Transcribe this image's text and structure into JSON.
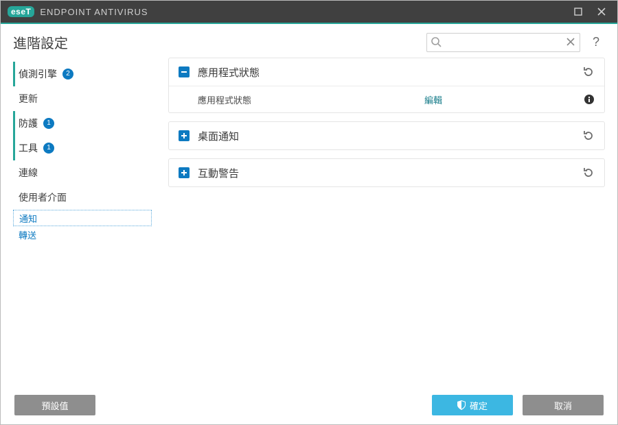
{
  "titlebar": {
    "brand_short": "eseT",
    "brand_text": "ENDPOINT ANTIVIRUS"
  },
  "header": {
    "title": "進階設定",
    "search_placeholder": ""
  },
  "sidebar": {
    "items": [
      {
        "label": "偵測引擎",
        "badge": "2"
      },
      {
        "label": "更新"
      },
      {
        "label": "防護",
        "badge": "1"
      },
      {
        "label": "工具",
        "badge": "1"
      },
      {
        "label": "連線"
      },
      {
        "label": "使用者介面"
      }
    ],
    "sub": [
      {
        "label": "通知"
      },
      {
        "label": "轉送"
      }
    ]
  },
  "panels": {
    "p0": {
      "title": "應用程式狀態",
      "row_label": "應用程式狀態",
      "row_link": "編輯"
    },
    "p1": {
      "title": "桌面通知"
    },
    "p2": {
      "title": "互動警告"
    }
  },
  "footer": {
    "defaults": "預設值",
    "ok": "確定",
    "cancel": "取消"
  }
}
